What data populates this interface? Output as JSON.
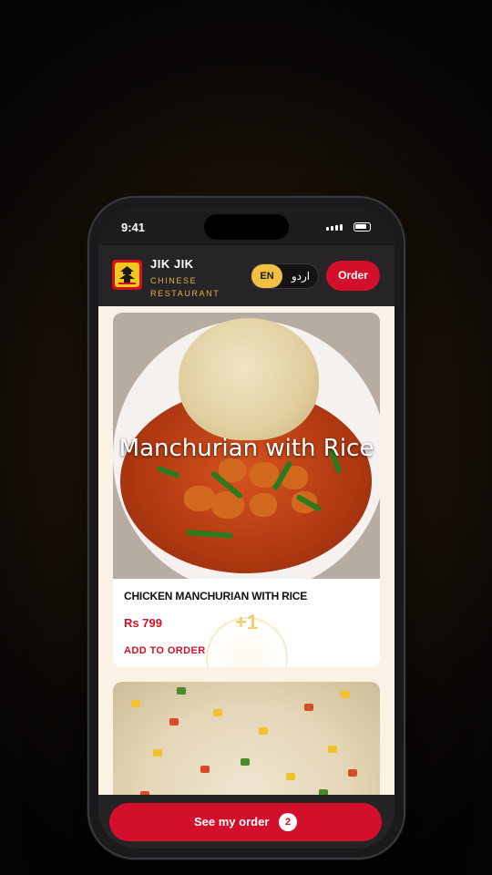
{
  "status_bar": {
    "time": "9:41"
  },
  "header": {
    "brand": "JIK JIK",
    "subtitle_line1": "CHINESE",
    "subtitle_line2": "RESTAURANT",
    "lang_en": "EN",
    "lang_ur": "اردو",
    "order_label": "Order"
  },
  "menu": {
    "items": [
      {
        "image_caption": "Manchurian with Rice",
        "name": "CHICKEN MANCHURIAN WITH RICE",
        "price": "Rs 799",
        "add_label": "ADD TO ORDER",
        "feedback": "+1"
      }
    ]
  },
  "footer": {
    "see_order_label": "See my order",
    "order_count": "2"
  },
  "colors": {
    "accent_red": "#d40f2c",
    "gold": "#f1c045",
    "content_bg": "#fbf1e5"
  },
  "icons": [
    "logo-icon",
    "signal-icon",
    "battery-icon"
  ]
}
